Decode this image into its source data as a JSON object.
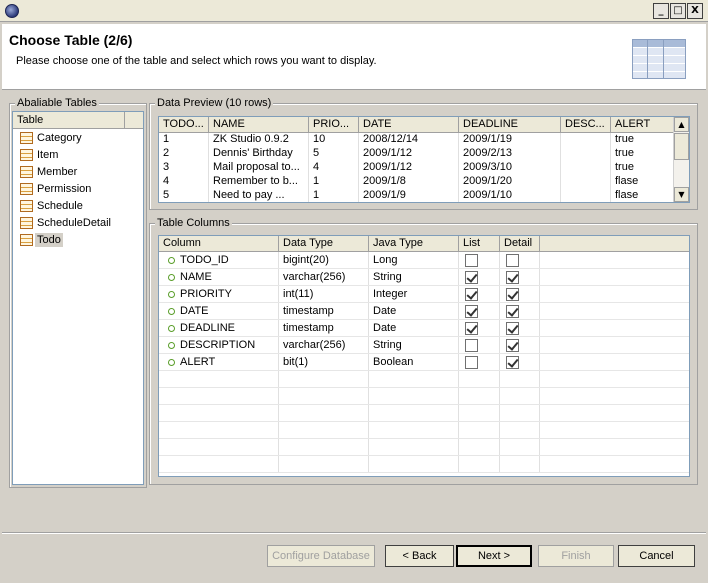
{
  "window": {
    "minimize": "_",
    "maximize": "□",
    "close": "X"
  },
  "header": {
    "title": "Choose Table (2/6)",
    "description": "Please choose one of the table and select which rows you want to display."
  },
  "tables_group": {
    "label": "Abaliable Tables",
    "column_header": "Table",
    "items": [
      "Category",
      "Item",
      "Member",
      "Permission",
      "Schedule",
      "ScheduleDetail",
      "Todo"
    ],
    "selected": "Todo"
  },
  "preview": {
    "label": "Data Preview (10 rows)",
    "columns": [
      "TODO...",
      "NAME",
      "PRIO...",
      "DATE",
      "DEADLINE",
      "DESC...",
      "ALERT"
    ],
    "rows": [
      [
        "1",
        "ZK Studio 0.9.2",
        "10",
        "2008/12/14",
        "2009/1/19",
        "",
        "true"
      ],
      [
        "2",
        "Dennis' Birthday",
        "5",
        "2009/1/12",
        "2009/2/13",
        "",
        "true"
      ],
      [
        "3",
        "Mail proposal to...",
        "4",
        "2009/1/12",
        "2009/3/10",
        "",
        "true"
      ],
      [
        "4",
        "Remember to b...",
        "1",
        "2009/1/8",
        "2009/1/20",
        "",
        "flase"
      ],
      [
        "5",
        "Need to pay ...",
        "1",
        "2009/1/9",
        "2009/1/10",
        "",
        "flase"
      ]
    ]
  },
  "columns_group": {
    "label": "Table Columns",
    "headers": [
      "Column",
      "Data Type",
      "Java Type",
      "List",
      "Detail"
    ],
    "rows": [
      {
        "column": "TODO_ID",
        "data_type": "bigint(20)",
        "java_type": "Long",
        "list": false,
        "detail": false
      },
      {
        "column": "NAME",
        "data_type": "varchar(256)",
        "java_type": "String",
        "list": true,
        "detail": true
      },
      {
        "column": "PRIORITY",
        "data_type": "int(11)",
        "java_type": "Integer",
        "list": true,
        "detail": true
      },
      {
        "column": "DATE",
        "data_type": "timestamp",
        "java_type": "Date",
        "list": true,
        "detail": true
      },
      {
        "column": "DEADLINE",
        "data_type": "timestamp",
        "java_type": "Date",
        "list": true,
        "detail": true
      },
      {
        "column": "DESCRIPTION",
        "data_type": "varchar(256)",
        "java_type": "String",
        "list": false,
        "detail": true
      },
      {
        "column": "ALERT",
        "data_type": "bit(1)",
        "java_type": "Boolean",
        "list": false,
        "detail": true
      }
    ]
  },
  "buttons": {
    "configure": "Configure Database",
    "back": "< Back",
    "next": "Next >",
    "finish": "Finish",
    "cancel": "Cancel"
  }
}
